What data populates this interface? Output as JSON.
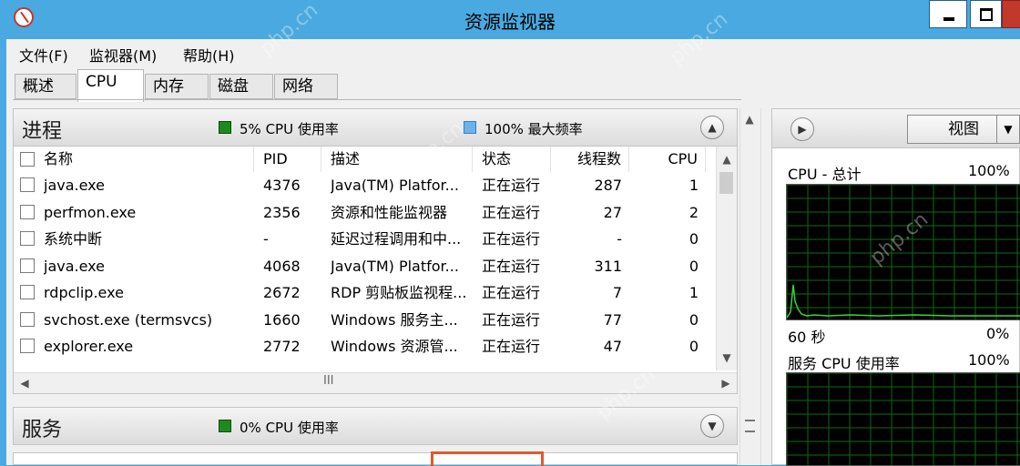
{
  "window": {
    "title": "资源监视器"
  },
  "menu": [
    "文件(F)",
    "监视器(M)",
    "帮助(H)"
  ],
  "tabs": [
    "概述",
    "CPU",
    "内存",
    "磁盘",
    "网络"
  ],
  "active_tab": "CPU",
  "processes": {
    "title": "进程",
    "cpu_usage": "5% CPU 使用率",
    "max_freq": "100% 最大频率",
    "columns": [
      "名称",
      "PID",
      "描述",
      "状态",
      "线程数",
      "CPU"
    ],
    "rows": [
      [
        "java.exe",
        "4376",
        "Java(TM) Platfor...",
        "正在运行",
        "287",
        "1"
      ],
      [
        "perfmon.exe",
        "2356",
        "资源和性能监视器",
        "正在运行",
        "27",
        "2"
      ],
      [
        "系统中断",
        "-",
        "延迟过程调用和中...",
        "正在运行",
        "-",
        "0"
      ],
      [
        "java.exe",
        "4068",
        "Java(TM) Platfor...",
        "正在运行",
        "311",
        "0"
      ],
      [
        "rdpclip.exe",
        "2672",
        "RDP 剪贴板监视程...",
        "正在运行",
        "7",
        "1"
      ],
      [
        "svchost.exe (termsvcs)",
        "1660",
        "Windows 服务主...",
        "正在运行",
        "77",
        "0"
      ],
      [
        "explorer.exe",
        "2772",
        "Windows 资源管...",
        "正在运行",
        "47",
        "0"
      ]
    ],
    "hscroll_grip": "III"
  },
  "services": {
    "title": "服务",
    "cpu_usage": "0% CPU 使用率"
  },
  "right_panel": {
    "view_label": "视图",
    "graph1": {
      "title": "CPU - 总计",
      "max": "100%",
      "time": "60 秒",
      "min": "0%"
    },
    "graph2": {
      "title": "服务 CPU 使用率",
      "max": "100%"
    }
  },
  "watermark": "php.cn",
  "colors": {
    "titlebar": "#4aa9e0",
    "cpu_green": "#1e8a1e",
    "freq_blue": "#6fb1ec",
    "graph_grid": "#0e6b0e"
  }
}
